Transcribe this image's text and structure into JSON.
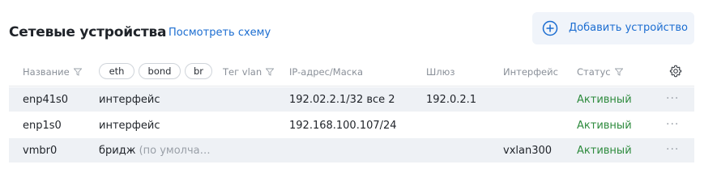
{
  "header": {
    "title": "Сетевые устройства",
    "scheme_link": "Посмотреть схему",
    "add_button": "Добавить устройство"
  },
  "table": {
    "columns": {
      "name": "Название",
      "chips": [
        "eth",
        "bond",
        "br"
      ],
      "vlan_tag": "Тег vlan",
      "ip": "IP-адрес/Маска",
      "gateway": "Шлюз",
      "interface": "Интерфейс",
      "status": "Статус"
    },
    "rows": [
      {
        "name": "enp41s0",
        "type": "интерфейс",
        "type_note": "",
        "ip": "192.02.2.1/32 все 2",
        "gateway": "192.0.2.1",
        "interface": "",
        "status": "Активный"
      },
      {
        "name": "enp1s0",
        "type": "интерфейс",
        "type_note": "",
        "ip": "192.168.100.107/24",
        "gateway": "",
        "interface": "",
        "status": "Активный"
      },
      {
        "name": "vmbr0",
        "type": "бридж",
        "type_note": "(по умолча…",
        "ip": "",
        "gateway": "",
        "interface": "vxlan300",
        "status": "Активный"
      }
    ],
    "row_menu": "···"
  },
  "colors": {
    "accent": "#1b6dd1",
    "status_active": "#2e8b3e",
    "row_shade": "#eef1f5",
    "button_bg": "#f0f4fa"
  },
  "icons": {
    "add": "plus-circle-icon",
    "filter": "funnel-icon",
    "settings": "gear-icon",
    "more": "ellipsis-icon"
  }
}
